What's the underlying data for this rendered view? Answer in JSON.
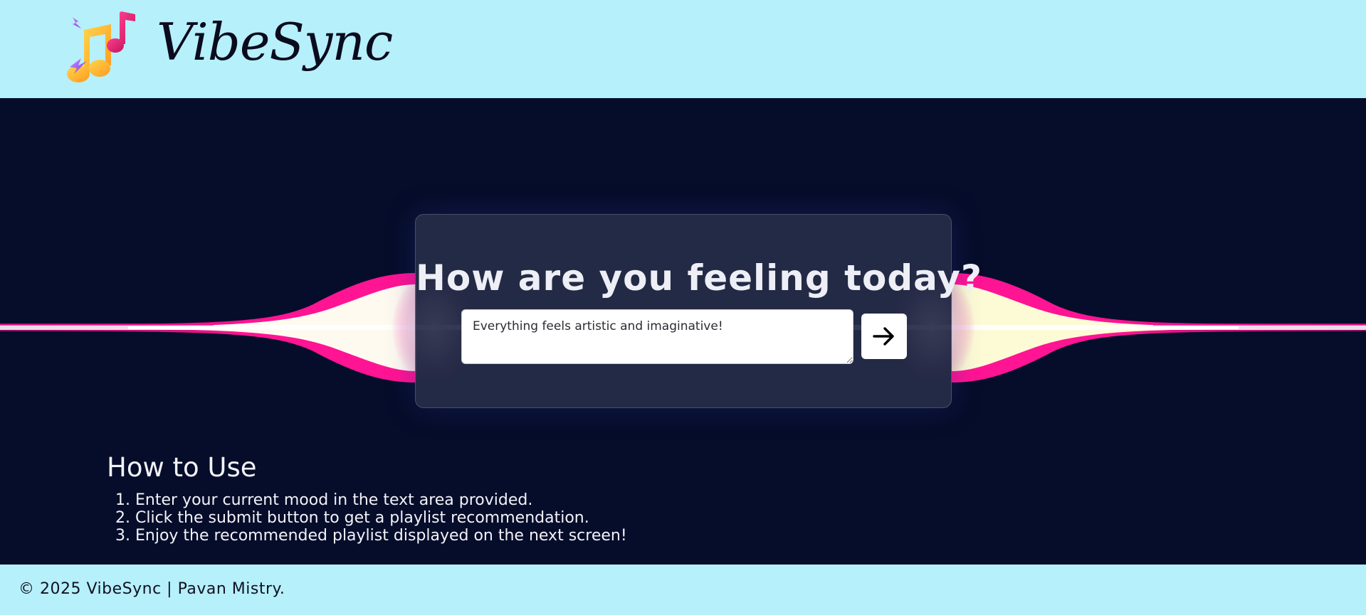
{
  "header": {
    "logo_icon": "music-notes-icon",
    "brand": "VibeSync"
  },
  "mood_card": {
    "title": "How are you feeling today?",
    "input_value": "Everything feels artistic and imaginative!",
    "submit_icon": "arrow-right-icon"
  },
  "how_to_use": {
    "title": "How to Use",
    "steps": [
      "Enter your current mood in the text area provided.",
      "Click the submit button to get a playlist recommendation.",
      "Enjoy the recommended playlist displayed on the next screen!"
    ]
  },
  "footer": {
    "text": "© 2025 VibeSync | Pavan Mistry."
  },
  "colors": {
    "header_bg": "#b6f0fb",
    "main_bg": "#060d2a",
    "wave_pink": "#ff1493",
    "wave_yellow": "#fff8c8"
  }
}
